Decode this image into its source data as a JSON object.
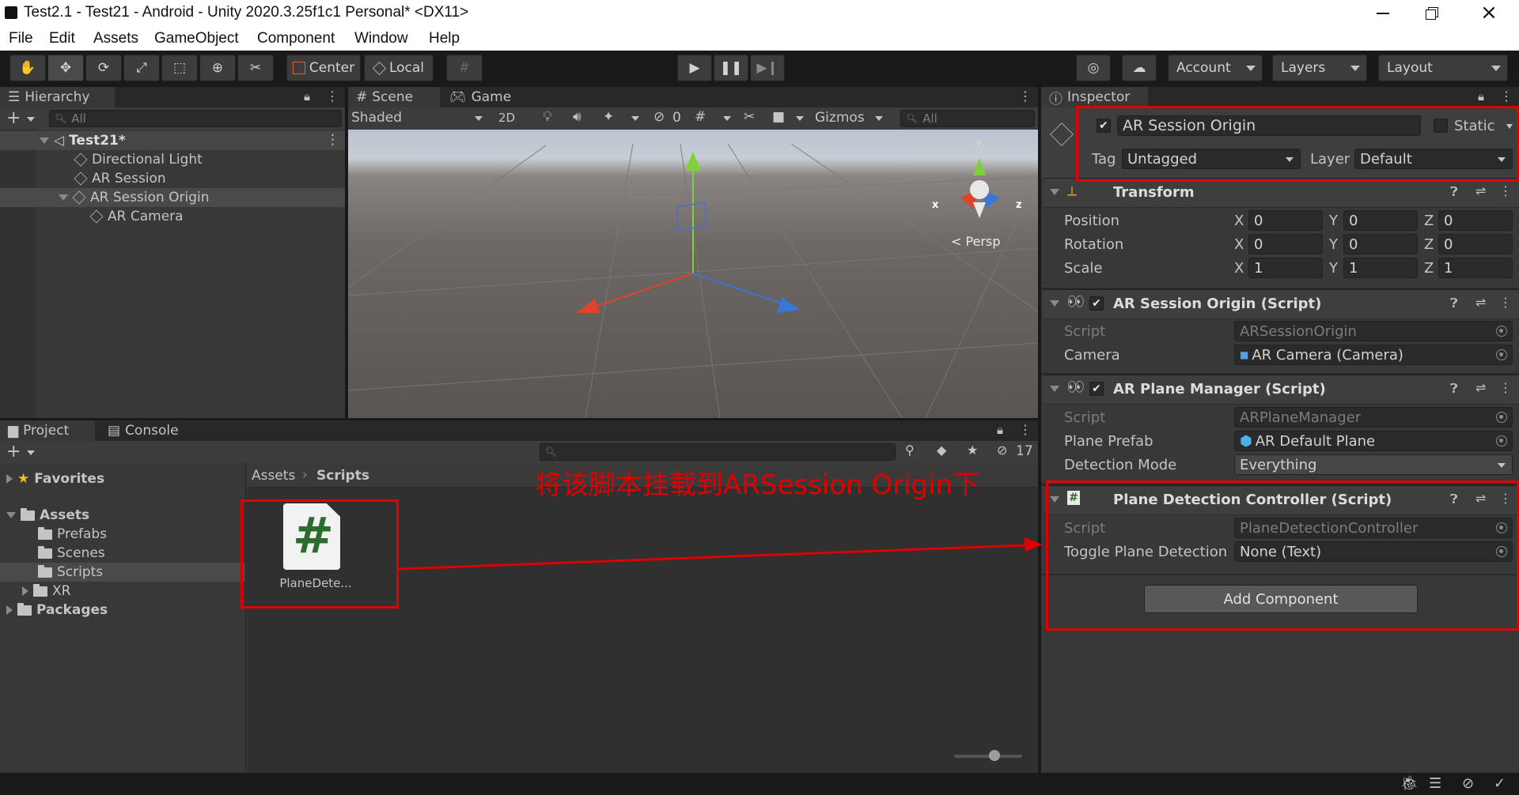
{
  "window": {
    "title": "Test2.1 - Test21 - Android - Unity 2020.3.25f1c1 Personal* <DX11>"
  },
  "menu": [
    "File",
    "Edit",
    "Assets",
    "GameObject",
    "Component",
    "Window",
    "Help"
  ],
  "toolbar": {
    "pivot_label": "Center",
    "space_label": "Local",
    "account_label": "Account",
    "layers_label": "Layers",
    "layout_label": "Layout"
  },
  "hierarchy": {
    "tab_label": "Hierarchy",
    "search_placeholder": "All",
    "scene_name": "Test21*",
    "items": [
      "Directional Light",
      "AR Session",
      "AR Session Origin",
      "AR Camera"
    ]
  },
  "scene": {
    "tab_label": "Scene",
    "game_tab_label": "Game",
    "draw_mode": "Shaded",
    "mode_2d": "2D",
    "hidden_count": "0",
    "gizmos_label": "Gizmos",
    "search_placeholder": "All",
    "persp_label": "Persp",
    "axis_x": "x",
    "axis_y": "y",
    "axis_z": "z"
  },
  "project": {
    "tab_label": "Project",
    "console_tab_label": "Console",
    "hidden_count": "17",
    "favorites_label": "Favorites",
    "assets_label": "Assets",
    "folders": [
      "Prefabs",
      "Scenes",
      "Scripts",
      "XR"
    ],
    "packages_label": "Packages",
    "breadcrumb": [
      "Assets",
      "Scripts"
    ],
    "asset_name": "PlaneDete...",
    "script_glyph": "#"
  },
  "annotation": {
    "text": "将该脚本挂载到ARSession Origin下",
    "color": "#e00000"
  },
  "inspector": {
    "tab_label": "Inspector",
    "object_name": "AR Session Origin",
    "static_label": "Static",
    "tag_label": "Tag",
    "tag_value": "Untagged",
    "layer_label": "Layer",
    "layer_value": "Default",
    "transform": {
      "title": "Transform",
      "rows": [
        {
          "label": "Position",
          "x": "0",
          "y": "0",
          "z": "0"
        },
        {
          "label": "Rotation",
          "x": "0",
          "y": "0",
          "z": "0"
        },
        {
          "label": "Scale",
          "x": "1",
          "y": "1",
          "z": "1"
        }
      ],
      "axis_labels": [
        "X",
        "Y",
        "Z"
      ]
    },
    "session_origin": {
      "title": "AR Session Origin (Script)",
      "script_label": "Script",
      "script_value": "ARSessionOrigin",
      "camera_label": "Camera",
      "camera_value": "AR Camera (Camera)"
    },
    "plane_manager": {
      "title": "AR Plane Manager (Script)",
      "script_label": "Script",
      "script_value": "ARPlaneManager",
      "prefab_label": "Plane Prefab",
      "prefab_value": "AR Default Plane",
      "mode_label": "Detection Mode",
      "mode_value": "Everything"
    },
    "plane_detection": {
      "title": "Plane Detection Controller (Script)",
      "script_label": "Script",
      "script_value": "PlaneDetectionController",
      "toggle_label": "Toggle Plane Detection",
      "toggle_value": "None (Text)"
    },
    "add_component_label": "Add Component"
  }
}
